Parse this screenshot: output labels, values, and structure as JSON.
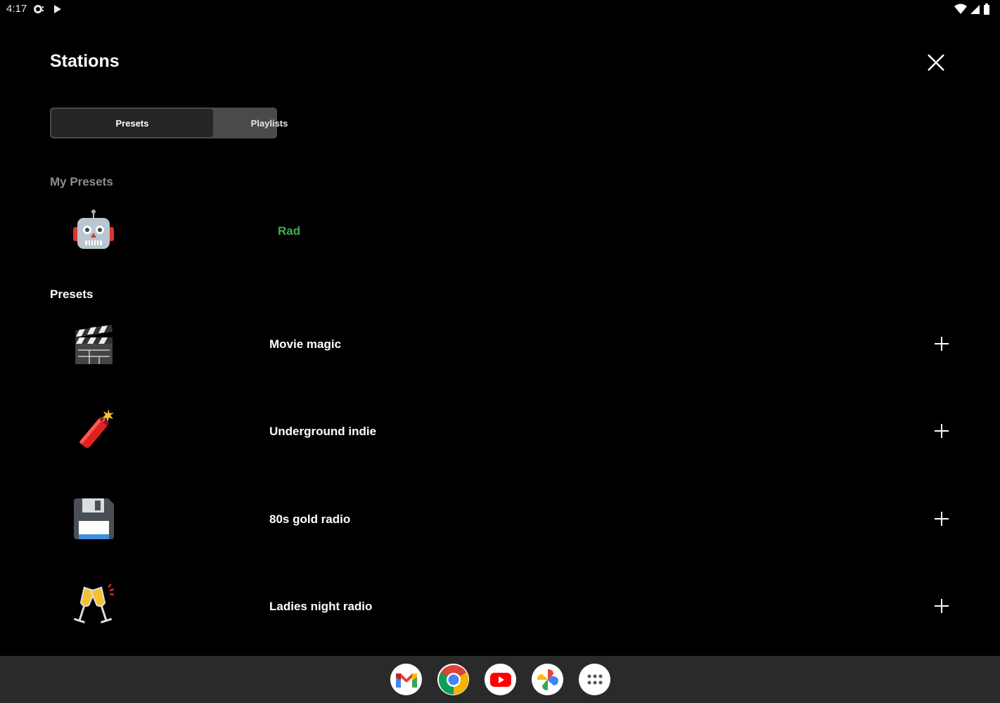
{
  "status_bar": {
    "time": "4:17",
    "left_icons": [
      "chat-notification-icon",
      "play-icon"
    ],
    "right_icons": [
      "wifi-icon",
      "cell-signal-icon",
      "battery-icon"
    ]
  },
  "header": {
    "title": "Stations",
    "close_icon": "close-icon"
  },
  "tabs": [
    {
      "label": "Presets",
      "active": true
    },
    {
      "label": "Playlists",
      "active": false
    }
  ],
  "my_presets": {
    "heading": "My Presets",
    "items": [
      {
        "label": "Rad",
        "icon": "robot-icon",
        "color": "#3fae54"
      }
    ]
  },
  "presets": {
    "heading": "Presets",
    "items": [
      {
        "label": "Movie magic",
        "icon": "clapperboard-icon",
        "action_icon": "plus-icon"
      },
      {
        "label": "Underground indie",
        "icon": "firecracker-icon",
        "action_icon": "plus-icon"
      },
      {
        "label": "80s gold radio",
        "icon": "floppy-disk-icon",
        "action_icon": "plus-icon"
      },
      {
        "label": "Ladies night radio",
        "icon": "clinking-glasses-icon",
        "action_icon": "plus-icon"
      }
    ]
  },
  "taskbar": {
    "apps": [
      "gmail-icon",
      "chrome-icon",
      "youtube-icon",
      "photos-icon",
      "app-drawer-icon"
    ]
  },
  "colors": {
    "background": "#000000",
    "accent_green": "#3fae54",
    "taskbar": "#2a2a2a",
    "segmented_bg": "#4a4a4a",
    "segmented_active": "#252525"
  }
}
